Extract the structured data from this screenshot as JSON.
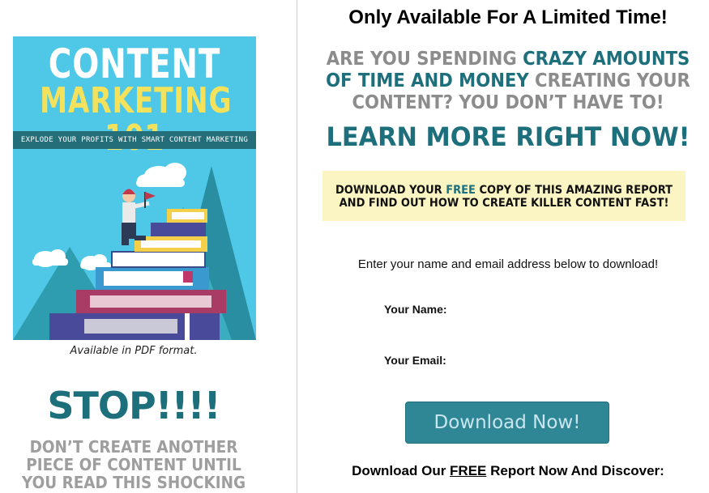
{
  "cover": {
    "title_line1": "CONTENT",
    "title_line2": "MARKETING 101",
    "subtitle": "EXPLODE YOUR PROFITS WITH SMART CONTENT MARKETING"
  },
  "left": {
    "format_note": "Available in PDF format.",
    "stop": "STOP!!!!",
    "stop_sub": [
      "DON’T CREATE ANOTHER",
      "PIECE OF CONTENT UNTIL",
      "YOU READ THIS SHOCKING"
    ]
  },
  "right": {
    "limited": "Only Available For A Limited Time!",
    "hook": {
      "p1": "ARE YOU SPENDING ",
      "h1": "CRAZY AMOUNTS",
      "h2": "OF TIME AND MONEY",
      "p2": " CREATING YOUR",
      "p3": "CONTENT? YOU DON’T HAVE TO!"
    },
    "learn_more": "LEARN MORE RIGHT NOW!",
    "yellow": {
      "a": "DOWNLOAD YOUR ",
      "free": "FREE",
      "b": " COPY OF THIS AMAZING REPORT",
      "line2": "AND FIND OUT HOW TO CREATE KILLER CONTENT FAST!"
    },
    "instruction": "Enter your name and email address below to download!",
    "name_label": "Your Name:",
    "name_value": "",
    "email_label": "Your Email:",
    "email_value": "",
    "button_label": "Download Now!",
    "discover": {
      "a": "Download Our ",
      "free": "FREE",
      "b": " Report Now And Discover:"
    }
  },
  "colors": {
    "accent": "#1d6f7c",
    "gray_text": "#8c8c8c",
    "highlight_box": "#fbf5c3",
    "button": "#2f8796",
    "cover_bg": "#4ec8e6"
  },
  "icons": [
    "ebook-cover-illustration"
  ]
}
